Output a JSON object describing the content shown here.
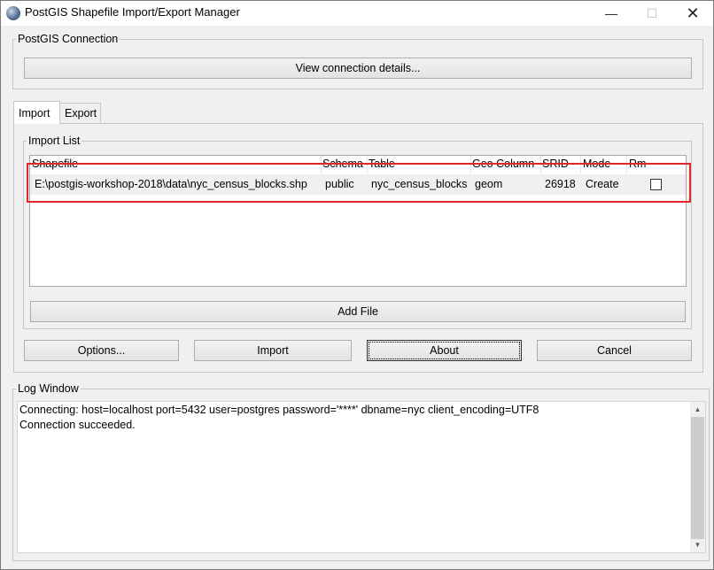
{
  "window": {
    "title": "PostGIS Shapefile Import/Export Manager",
    "buttons": {
      "minimize": "—",
      "maximize": "☐",
      "close": "✕"
    }
  },
  "connection": {
    "legend": "PostGIS Connection",
    "view_details_label": "View connection details..."
  },
  "tabs": [
    {
      "label": "Import",
      "active": true
    },
    {
      "label": "Export",
      "active": false
    }
  ],
  "import_list": {
    "legend": "Import List",
    "columns": [
      "Shapefile",
      "Schema",
      "Table",
      "Geo Column",
      "SRID",
      "Mode",
      "Rm"
    ],
    "rows": [
      {
        "shapefile": "E:\\postgis-workshop-2018\\data\\nyc_census_blocks.shp",
        "schema": "public",
        "table": "nyc_census_blocks",
        "geo_column": "geom",
        "srid": "26918",
        "mode": "Create",
        "rm": false
      }
    ],
    "add_file_label": "Add File"
  },
  "actions": {
    "options_label": "Options...",
    "import_label": "Import",
    "about_label": "About",
    "cancel_label": "Cancel"
  },
  "log": {
    "legend": "Log Window",
    "lines": [
      "Connecting:  host=localhost port=5432 user=postgres password='****' dbname=nyc client_encoding=UTF8",
      "Connection succeeded."
    ]
  },
  "colors": {
    "highlight": "#e0262b",
    "selected_row": "#f0f0f0"
  }
}
